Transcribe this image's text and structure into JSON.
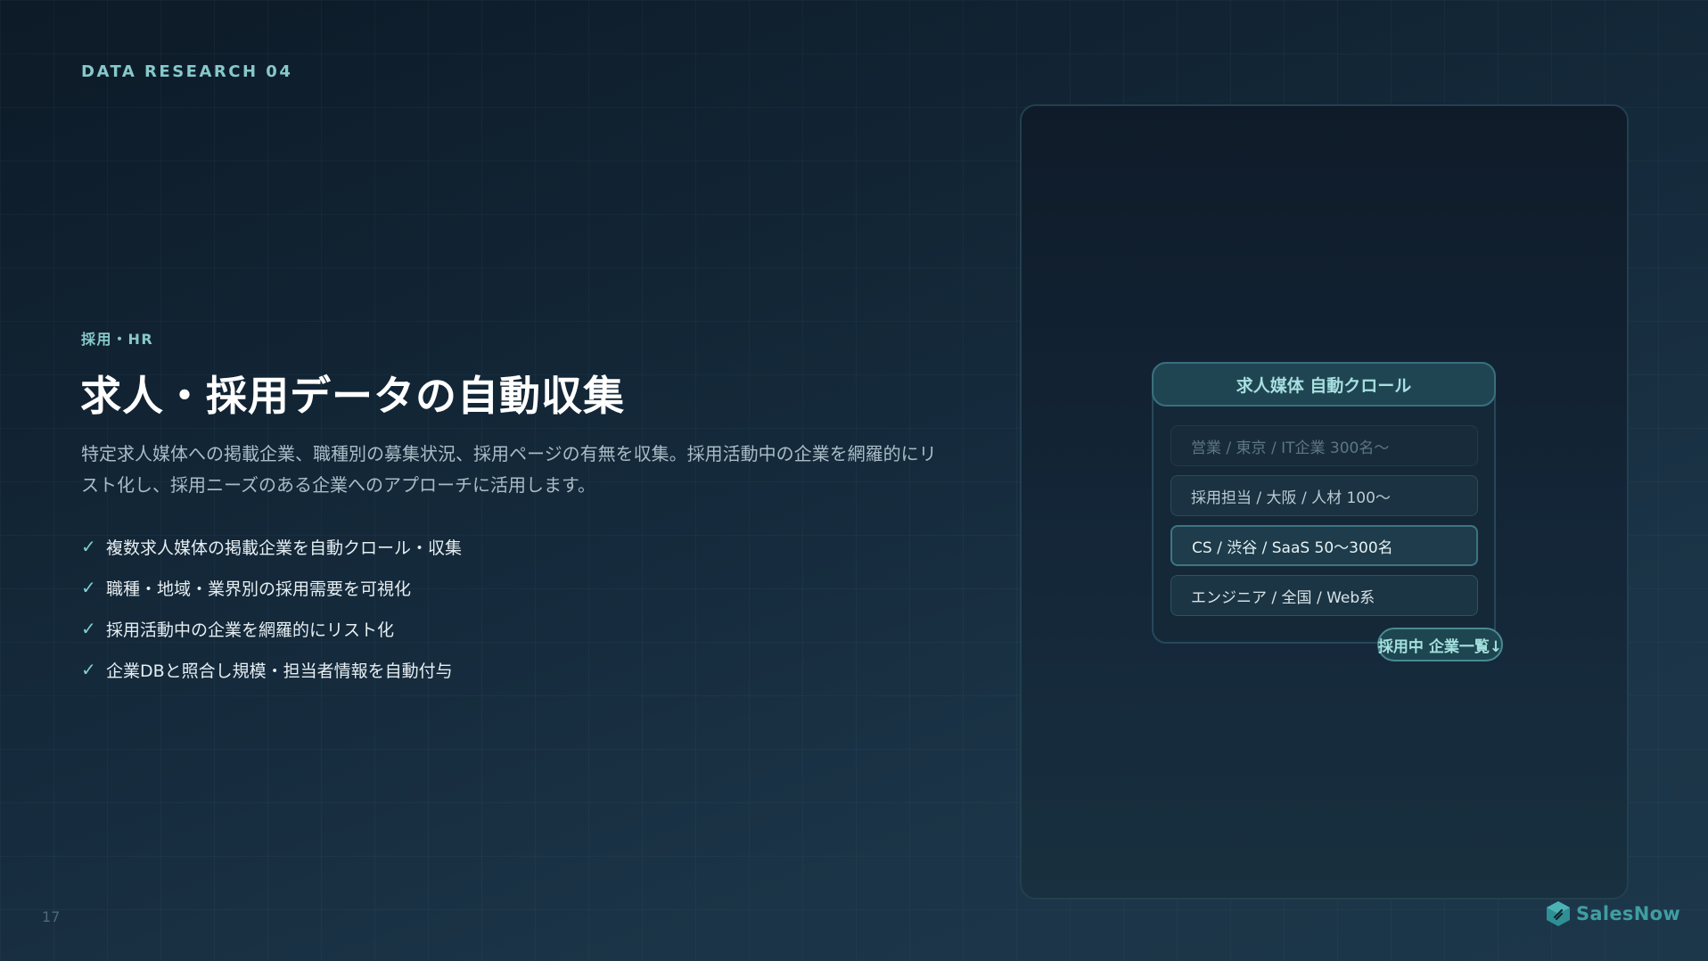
{
  "slide": {
    "eyebrow": "DATA RESEARCH 04",
    "tag": "採用・HR",
    "title": "求人・採用データの自動収集",
    "description": "特定求人媒体への掲載企業、職種別の募集状況、採用ページの有無を収集。採用活動中の企業を網羅的にリスト化し、採用ニーズのある企業へのアプローチに活用します。",
    "checks": [
      "複数求人媒体の掲載企業を自動クロール・収集",
      "職種・地域・業界別の採用需要を可視化",
      "採用活動中の企業を網羅的にリスト化",
      "企業DBと照合し規模・担当者情報を自動付与"
    ],
    "check_icon": "check-icon",
    "page_number": "17"
  },
  "panel": {
    "header": "求人媒体 自動クロール",
    "rows": [
      "営業 / 東京 / IT企業 300名〜",
      "採用担当 / 大阪 / 人材 100〜",
      "CS / 渋谷 / SaaS 50〜300名",
      "エンジニア / 全国 / Web系"
    ],
    "cta": "採用中 企業一覧↓"
  },
  "brand": {
    "name": "SalesNow",
    "logo_icon": "salesnow-logo-icon",
    "accent": "#86c9cb"
  }
}
